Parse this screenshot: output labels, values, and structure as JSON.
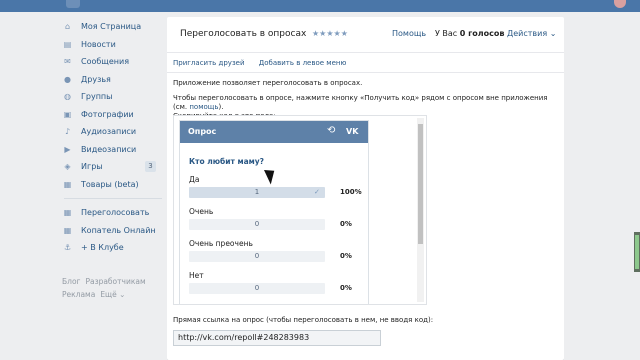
{
  "sidebar": {
    "items": [
      {
        "label": "Моя Страница",
        "icon": "home-icon",
        "glyph": "⌂"
      },
      {
        "label": "Новости",
        "icon": "news-icon",
        "glyph": "▤"
      },
      {
        "label": "Сообщения",
        "icon": "messages-icon",
        "glyph": "✉"
      },
      {
        "label": "Друзья",
        "icon": "friends-icon",
        "glyph": "●"
      },
      {
        "label": "Группы",
        "icon": "groups-icon",
        "glyph": "◍"
      },
      {
        "label": "Фотографии",
        "icon": "photos-icon",
        "glyph": "▣"
      },
      {
        "label": "Аудиозаписи",
        "icon": "music-icon",
        "glyph": "♪"
      },
      {
        "label": "Видеозаписи",
        "icon": "video-icon",
        "glyph": "▶"
      },
      {
        "label": "Игры",
        "icon": "games-icon",
        "glyph": "◈",
        "count": "3"
      },
      {
        "label": "Товары (beta)",
        "icon": "goods-icon",
        "glyph": "▦"
      }
    ],
    "apps": [
      {
        "label": "Переголосовать",
        "icon": "app-grid-icon",
        "glyph": "▦"
      },
      {
        "label": "Копатель Онлайн",
        "icon": "app-grid-icon",
        "glyph": "▦"
      },
      {
        "label": "В Клубе",
        "icon": "anchor-icon",
        "glyph": "⚓",
        "prefix": "+ "
      }
    ],
    "footer": [
      "Блог",
      "Разработчикам",
      "Реклама",
      "Ещё ⌄"
    ]
  },
  "header": {
    "title": "Переголосовать в опросах",
    "stars": "★★★★★",
    "help": "Помощь",
    "you_have_prefix": "У Вас",
    "votes": "0 голосов",
    "actions": "Действия ⌄"
  },
  "subnav": {
    "invite": "Пригласить друзей",
    "add_menu": "Добавить в левое меню"
  },
  "description": {
    "line1": "Приложение позволяет переголосовать в опросах.",
    "line2a": "Чтобы переголосовать в опросе, нажмите кнопку «Получить код» рядом с опросом вне приложения (см.",
    "line2_link": "помощь",
    "line2b": ").",
    "line3": "Скопируйте код в это поле:"
  },
  "poll": {
    "header": "Опрос",
    "question": "Кто любит маму?",
    "options": [
      {
        "label": "Да",
        "count": "1",
        "percent": "100%",
        "selected": true
      },
      {
        "label": "Очень",
        "count": "0",
        "percent": "0%"
      },
      {
        "label": "Очень преочень",
        "count": "0",
        "percent": "0%"
      },
      {
        "label": "Нет",
        "count": "0",
        "percent": "0%"
      }
    ]
  },
  "direct_link": {
    "label": "Прямая ссылка на опрос (чтобы переголосовать в нем, не вводя код):",
    "value": "http://vk.com/repoll#248283983"
  },
  "colors": {
    "brand": "#4a76a8",
    "poll_header": "#5e81a8",
    "link": "#2a5885"
  }
}
